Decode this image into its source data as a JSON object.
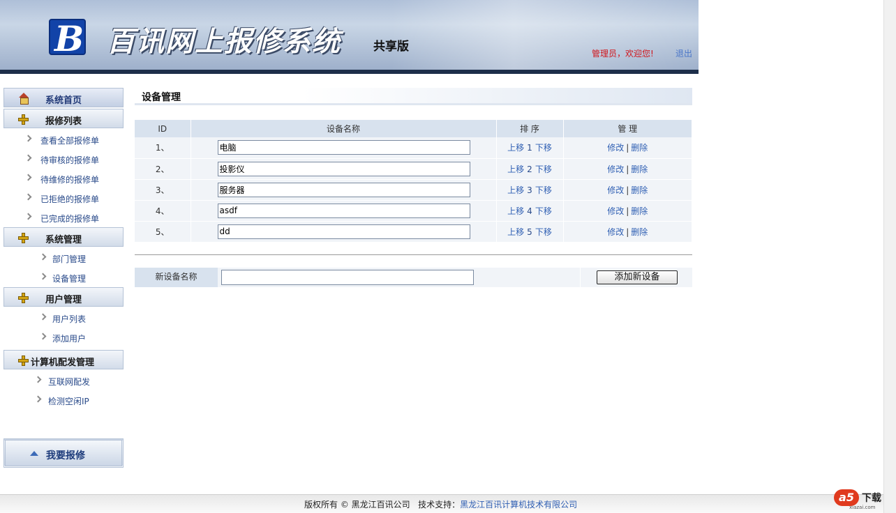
{
  "header": {
    "logo_letter": "B",
    "title": "百讯网上报修系统",
    "edition": "共享版",
    "welcome": "管理员，欢迎您!",
    "logout": "退出"
  },
  "sidebar": {
    "home": "系统首页",
    "sections": [
      {
        "label": "报修列表",
        "items": [
          "查看全部报修单",
          "待审核的报修单",
          "待维修的报修单",
          "已拒绝的报修单",
          "已完成的报修单"
        ]
      },
      {
        "label": "系统管理",
        "items": [
          "部门管理",
          "设备管理"
        ]
      },
      {
        "label": "用户管理",
        "items": [
          "用户列表",
          "添加用户"
        ]
      },
      {
        "label": "计算机配发管理",
        "items": [
          "互联网配发",
          "检测空闲IP"
        ]
      }
    ],
    "repair_button": "我要报修"
  },
  "main": {
    "title": "设备管理",
    "columns": [
      "ID",
      "设备名称",
      "排 序",
      "管 理"
    ],
    "rows": [
      {
        "id": "1、",
        "name": "电脑",
        "order": "1"
      },
      {
        "id": "2、",
        "name": "投影仪",
        "order": "2"
      },
      {
        "id": "3、",
        "name": "服务器",
        "order": "3"
      },
      {
        "id": "4、",
        "name": "asdf",
        "order": "4"
      },
      {
        "id": "5、",
        "name": "dd",
        "order": "5"
      }
    ],
    "move_up": "上移",
    "move_down": "下移",
    "edit": "修改",
    "delete": "删除",
    "sep": "|",
    "add_label": "新设备名称",
    "add_value": "",
    "add_button": "添加新设备"
  },
  "footer": {
    "copyright": "版权所有 © 黑龙江百讯公司",
    "support_label": "技术支持：",
    "support_company": "黑龙江百讯计算机技术有限公司"
  },
  "watermark": {
    "logo": "a5",
    "text": "下载",
    "url": "xiazai.com"
  },
  "colors": {
    "header_dark": "#1d2e4a",
    "link": "#2f5fb3",
    "welcome": "#d0141a",
    "table_head": "#d8e2ee",
    "table_row": "#f1f4f8"
  }
}
